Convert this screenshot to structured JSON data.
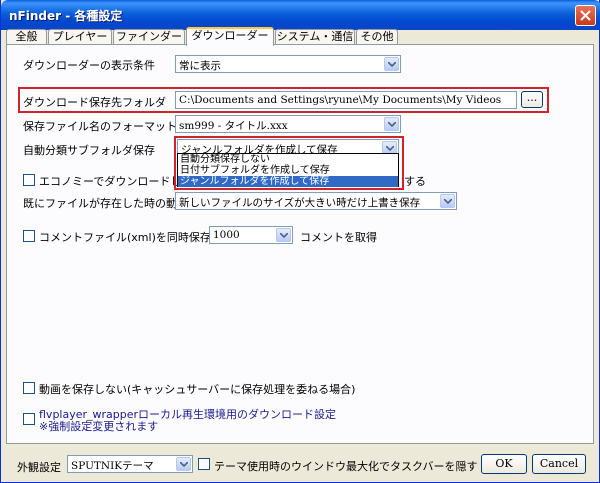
{
  "window": {
    "title": "nFinder - 各種設定"
  },
  "tabs": [
    {
      "label": "全般"
    },
    {
      "label": "プレイヤー"
    },
    {
      "label": "ファインダー"
    },
    {
      "label": "ダウンローダー"
    },
    {
      "label": "システム・通信"
    },
    {
      "label": "その他"
    }
  ],
  "settings": {
    "display_condition": {
      "label": "ダウンローダーの表示条件",
      "value": "常に表示"
    },
    "save_folder": {
      "label": "ダウンロード保存先フォルダ",
      "value": "C:\\Documents and Settings\\ryune\\My Documents\\My Videos",
      "browse_label": "..."
    },
    "filename_format": {
      "label": "保存ファイル名のフォーマット",
      "value": "sm999 - タイトル.xxx"
    },
    "auto_subfolder": {
      "label": "自動分類サブフォルダ保存",
      "value": "ジャンルフォルダを作成して保存",
      "options": [
        "自動分類保存しない",
        "日付サブフォルダを作成して保存",
        "ジャンルフォルダを作成して保存"
      ]
    },
    "economy": {
      "label": "エコノミーでダウンロードし",
      "suffix": "する"
    },
    "existing_file": {
      "label": "既にファイルが存在した時の動作",
      "value": "新しいファイルのサイズが大きい時だけ上書き保存"
    },
    "comment_file": {
      "label": "コメントファイル(xml)を同時保存す",
      "value": "1000",
      "suffix": "コメントを取得"
    },
    "no_save_video": {
      "label": "動画を保存しない(キャッシュサーバーに保存処理を委ねる場合)"
    },
    "flvplayer": {
      "label_line1": "flvplayer_wrapperローカル再生環境用のダウンロード設定",
      "label_line2": "※強制設定変更されます"
    }
  },
  "footer": {
    "theme_label": "外観設定",
    "theme_value": "SPUTNIKテーマ",
    "maximize_label": "テーマ使用時のウインドウ最大化でタスクバーを隠す",
    "ok_label": "OK",
    "cancel_label": "Cancel"
  },
  "colors": {
    "title_bar": "#0a5fd8",
    "highlight": "#d2232a",
    "selected": "#316ac5"
  }
}
